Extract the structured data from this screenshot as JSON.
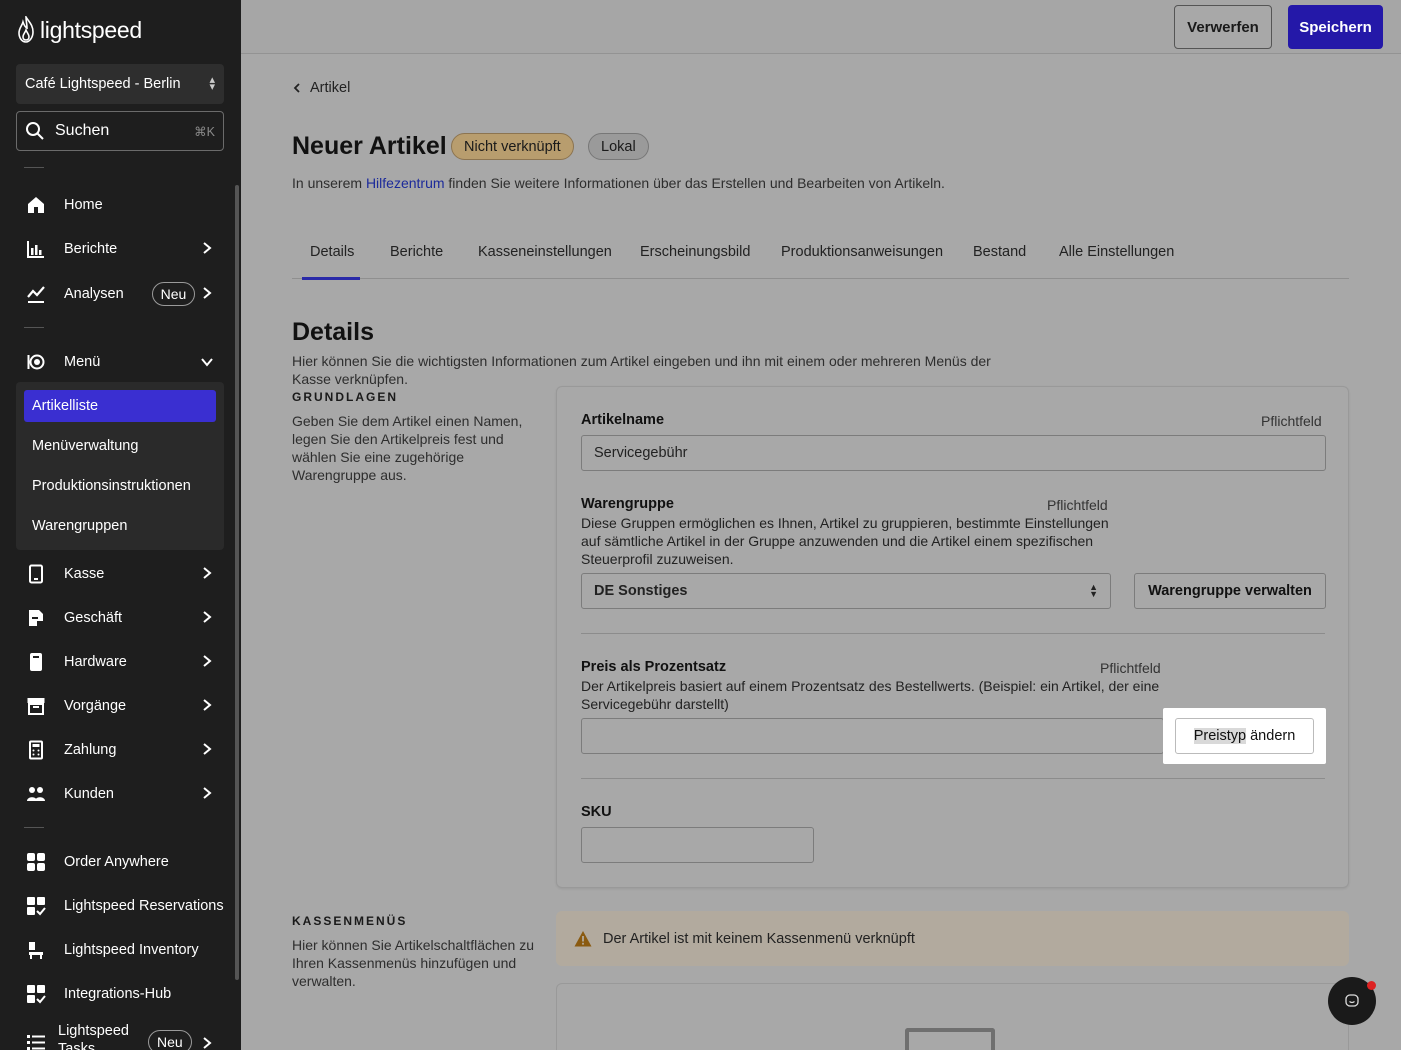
{
  "brand": {
    "name": "lightspeed"
  },
  "store": {
    "name": "Café Lightspeed - Berlin"
  },
  "search": {
    "label": "Suchen",
    "shortcut": "⌘K"
  },
  "sidebar": {
    "items": [
      {
        "label": "Home",
        "icon": "home-icon"
      },
      {
        "label": "Berichte",
        "icon": "bar-chart-icon"
      },
      {
        "label": "Analysen",
        "icon": "trend-icon",
        "badge": "Neu"
      },
      {
        "label": "Menü",
        "icon": "menu-dish-icon",
        "expanded": true
      },
      {
        "label": "Kasse",
        "icon": "tablet-icon"
      },
      {
        "label": "Geschäft",
        "icon": "store-doc-icon"
      },
      {
        "label": "Hardware",
        "icon": "device-icon"
      },
      {
        "label": "Vorgänge",
        "icon": "archive-icon"
      },
      {
        "label": "Zahlung",
        "icon": "calculator-icon"
      },
      {
        "label": "Kunden",
        "icon": "people-icon"
      },
      {
        "label": "Order Anywhere",
        "icon": "grid-icon"
      },
      {
        "label": "Lightspeed Reservations",
        "icon": "grid-check-icon"
      },
      {
        "label": "Lightspeed Inventory",
        "icon": "inventory-icon"
      },
      {
        "label": "Integrations-Hub",
        "icon": "grid-check-icon"
      },
      {
        "label": "Lightspeed Tasks",
        "icon": "list-icon",
        "badge": "Neu"
      }
    ],
    "submenu": [
      {
        "label": "Artikelliste",
        "active": true
      },
      {
        "label": "Menüverwaltung"
      },
      {
        "label": "Produktionsinstruktionen"
      },
      {
        "label": "Warengruppen"
      }
    ]
  },
  "topbar": {
    "discard_label": "Verwerfen",
    "save_label": "Speichern",
    "save_color": "#2418a8"
  },
  "page": {
    "breadcrumb": "Artikel",
    "title": "Neuer Artikel",
    "tags": [
      "Nicht verknüpft",
      "Lokal"
    ],
    "help_prefix": "In unserem ",
    "help_link": "Hilfezentrum",
    "help_suffix": " finden Sie weitere Informationen über das Erstellen und Bearbeiten von Artikeln."
  },
  "tabs": [
    "Details",
    "Berichte",
    "Kasseneinstellungen",
    "Erscheinungsbild",
    "Produktionsanweisungen",
    "Bestand",
    "Alle Einstellungen"
  ],
  "details": {
    "title": "Details",
    "description": "Hier können Sie die wichtigsten Informationen zum Artikel eingeben und ihn mit einem oder mehreren Menüs der Kasse verknüpfen.",
    "basics": {
      "heading": "GRUNDLAGEN",
      "description": "Geben Sie dem Artikel einen Namen, legen Sie den Artikelpreis fest und wählen Sie eine zugehörige Warengruppe aus."
    },
    "required_label": "Pflichtfeld",
    "item_name": {
      "label": "Artikelname",
      "value": "Servicegebühr"
    },
    "product_group": {
      "label": "Warengruppe",
      "description": "Diese Gruppen ermöglichen es Ihnen, Artikel zu gruppieren, bestimmte Einstellungen auf sämtliche Artikel in der Gruppe anzuwenden und die Artikel einem spezifischen Steuerprofil zuzuweisen.",
      "selected": "DE Sonstiges",
      "manage_button": "Warengruppe verwalten"
    },
    "price": {
      "label": "Preis als Prozentsatz",
      "description": "Der Artikelpreis basiert auf einem Prozentsatz des Bestellwerts. (Beispiel: ein Artikel, der eine Servicegebühr darstellt)",
      "value": "",
      "change_button_selected": "Preistyp",
      "change_button_rest": " ändern"
    },
    "sku": {
      "label": "SKU",
      "value": ""
    }
  },
  "register_menus": {
    "heading": "KASSENMENÜS",
    "description": "Hier können Sie Artikelschaltflächen zu Ihren Kassenmenüs hinzufügen und verwalten.",
    "warning": "Der Artikel ist mit keinem Kassenmenü verknüpft"
  }
}
